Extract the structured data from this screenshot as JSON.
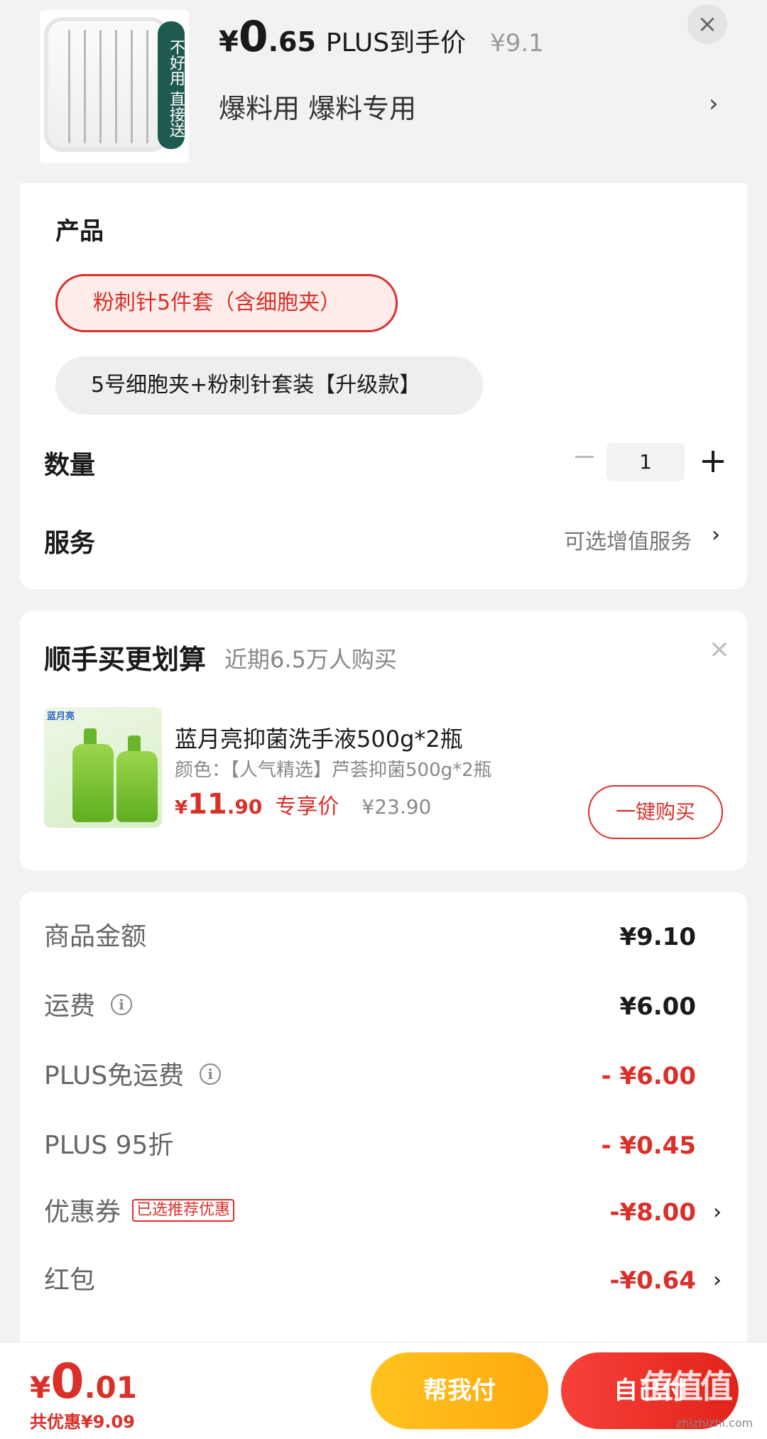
{
  "header": {
    "badge_text": "不好用 直接送",
    "price_yen": "¥",
    "price_int": "0",
    "price_dec": ".65",
    "price_label": "PLUS到手价",
    "original_price": "¥9.1",
    "subtitle": "爆料用  爆料专用",
    "arrow": "›",
    "close": "×"
  },
  "product_section": {
    "title": "产品",
    "options": [
      {
        "label": "粉刺针5件套（含细胞夹）",
        "selected": true
      },
      {
        "label": "5号细胞夹+粉刺针套装【升级款】",
        "selected": false
      }
    ],
    "quantity_label": "数量",
    "quantity_value": "1",
    "service_label": "服务",
    "service_value": "可选增值服务",
    "service_arrow": "›"
  },
  "addon": {
    "title": "顺手买更划算",
    "subtitle": "近期6.5万人购买",
    "close": "×",
    "image_brand": "蓝月亮",
    "name": "蓝月亮抑菌洗手液500g*2瓶",
    "spec": "颜色：【人气精选】芦荟抑菌500g*2瓶",
    "price_yen": "¥",
    "price_int": "11",
    "price_dec": ".90",
    "price_label": "专享价",
    "original_price": "¥23.90",
    "buy_label": "一键购买"
  },
  "summary": {
    "rows": [
      {
        "label": "商品金额",
        "value": "¥9.10"
      },
      {
        "label": "运费",
        "value": "¥6.00"
      },
      {
        "label": "PLUS免运费",
        "value": "- ¥6.00"
      },
      {
        "label": "PLUS 95折",
        "value": "- ¥0.45"
      },
      {
        "label": "优惠券",
        "tag": "已选推荐优惠",
        "value": "-¥8.00",
        "arrow": "›"
      },
      {
        "label": "红包",
        "value": "-¥0.64",
        "arrow": "›"
      }
    ],
    "info_glyph": "i"
  },
  "bottom_bar": {
    "total_yen": "¥",
    "total_int": "0",
    "total_dec": ".01",
    "saved_text": "共优惠¥9.09",
    "help_pay_label": "帮我付",
    "self_pay_label": "自己付",
    "watermark": "值值值",
    "watermark_url": "zhizhizhi.com"
  },
  "colors": {
    "accent_red": "#d9302a",
    "help_yellow": "#ffb416",
    "background": "#f2f2f2"
  }
}
